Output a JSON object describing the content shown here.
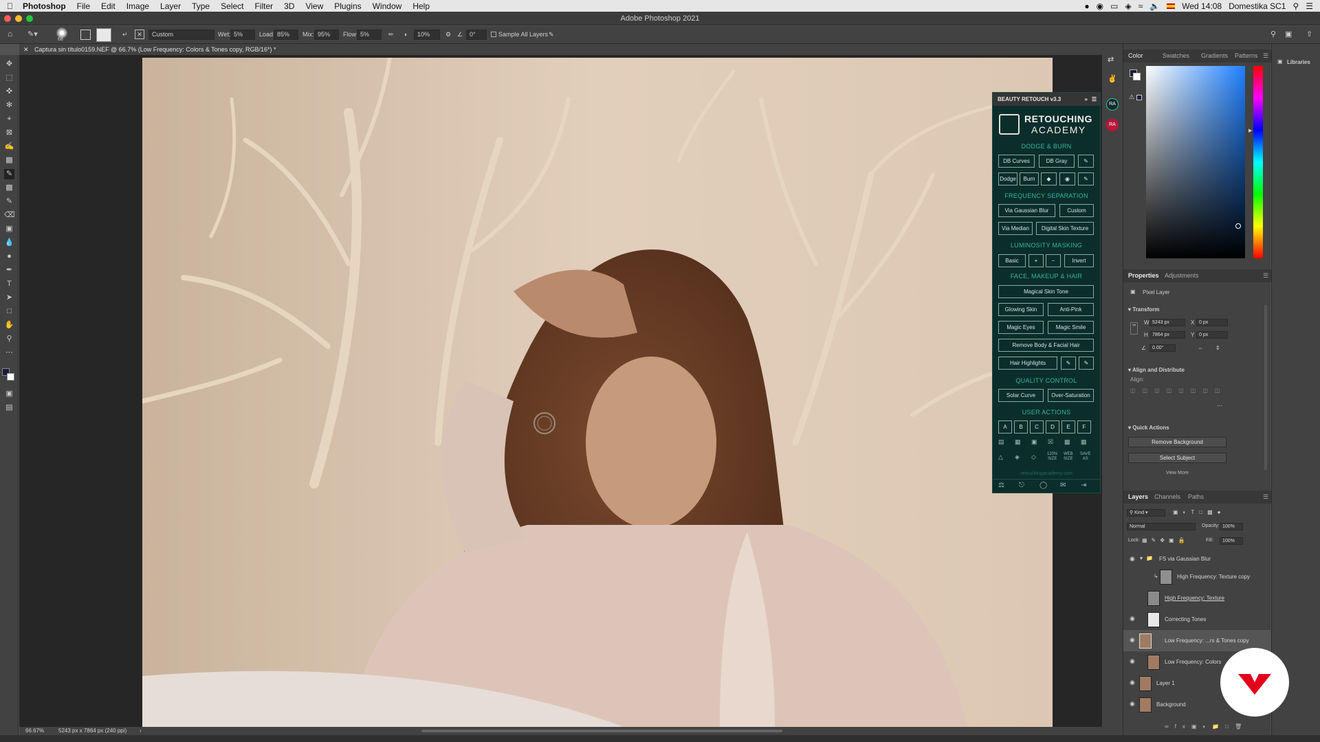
{
  "menubar": {
    "app": "Photoshop",
    "items": [
      "File",
      "Edit",
      "Image",
      "Layer",
      "Type",
      "Select",
      "Filter",
      "3D",
      "View",
      "Plugins",
      "Window",
      "Help"
    ],
    "clock": "Wed 14:08",
    "user": "Domestika SC1"
  },
  "window": {
    "title": "Adobe Photoshop 2021"
  },
  "options": {
    "preset": "Custom",
    "wet_label": "Wet:",
    "wet": "5%",
    "load_label": "Load:",
    "load": "85%",
    "mix_label": "Mix:",
    "mix": "95%",
    "flow_label": "Flow:",
    "flow": "5%",
    "smoothing": "10%",
    "angle": "0°",
    "sample_all": "Sample All Layers",
    "brush_size": "68"
  },
  "document": {
    "tab_title": "Captura sin título0159.NEF @ 66.7% (Low Frequency: Colors & Tones copy, RGB/16*) *"
  },
  "status": {
    "zoom": "66.67%",
    "info": "5243 px x 7864 px (240 ppi)"
  },
  "beauty": {
    "header": "BEAUTY RETOUCH v3.3",
    "logo_top": "RETOUCHING",
    "logo_bottom": "ACADEMY",
    "sections": {
      "dodge": "DODGE & BURN",
      "freq": "FREQUENCY SEPARATION",
      "lum": "LUMINOSITY MASKING",
      "face": "FACE, MAKEUP & HAIR",
      "qc": "QUALITY CONTROL",
      "user": "USER ACTIONS"
    },
    "buttons": {
      "db_curves": "DB Curves",
      "db_gray": "DB Gray",
      "dodge": "Dodge",
      "burn": "Burn",
      "via_gaussian": "Via Gaussian Blur",
      "custom": "Custom",
      "via_median": "Via Median",
      "digital_skin": "Digital Skin Texture",
      "basic": "Basic",
      "plus": "+",
      "minus": "−",
      "invert": "Invert",
      "magical_skin": "Magical Skin Tone",
      "glowing": "Glowing Skin",
      "anti_pink": "Anti-Pink",
      "magic_eyes": "Magic Eyes",
      "magic_smile": "Magic Smile",
      "remove_body": "Remove Body & Facial Hair",
      "hair_highlights": "Hair Highlights",
      "solar_curve": "Solar Curve",
      "over_saturation": "Over-Saturation"
    },
    "user_actions": [
      "A",
      "B",
      "C",
      "D",
      "E",
      "F"
    ],
    "mini_labels": [
      "120%",
      "SIZE",
      "WEB",
      "SIZE",
      "SAVE",
      "AS"
    ],
    "url": "retouchingacademy.com"
  },
  "color_panel": {
    "tabs": [
      "Color",
      "Swatches",
      "Gradients",
      "Patterns"
    ]
  },
  "properties": {
    "tabs": [
      "Properties",
      "Adjustments"
    ],
    "kind": "Pixel Layer",
    "transform": "Transform",
    "w_label": "W",
    "w": "5243 px",
    "h_label": "H",
    "h": "7864 px",
    "x_label": "X",
    "x": "0 px",
    "y_label": "Y",
    "y": "0 px",
    "angle": "0.00°",
    "align_title": "Align and Distribute",
    "align_label": "Align:",
    "quick_title": "Quick Actions",
    "remove_bg": "Remove Background",
    "select_subject": "Select Subject",
    "view_more": "View More"
  },
  "layers": {
    "tabs": [
      "Layers",
      "Channels",
      "Paths"
    ],
    "kind": "Kind",
    "blend": "Normal",
    "opacity_label": "Opacity:",
    "opacity": "100%",
    "lock_label": "Lock:",
    "fill_label": "Fill:",
    "fill": "100%",
    "items": [
      {
        "name": "FS via Gaussian Blur"
      },
      {
        "name": "High Frequency: Texture copy"
      },
      {
        "name": "High Frequency: Texture"
      },
      {
        "name": "Correcting Tones"
      },
      {
        "name": "Low Frequency: ...rs & Tones copy"
      },
      {
        "name": "Low Frequency: Colors"
      },
      {
        "name": "Layer 1"
      },
      {
        "name": "Background"
      }
    ]
  },
  "libraries": {
    "title": "Libraries"
  },
  "colors": {
    "teal": "#2fb9a3",
    "panel_bg": "#0c2e2a",
    "domestika": "#e2001a",
    "fg_swatch": "#1a1d3a"
  }
}
